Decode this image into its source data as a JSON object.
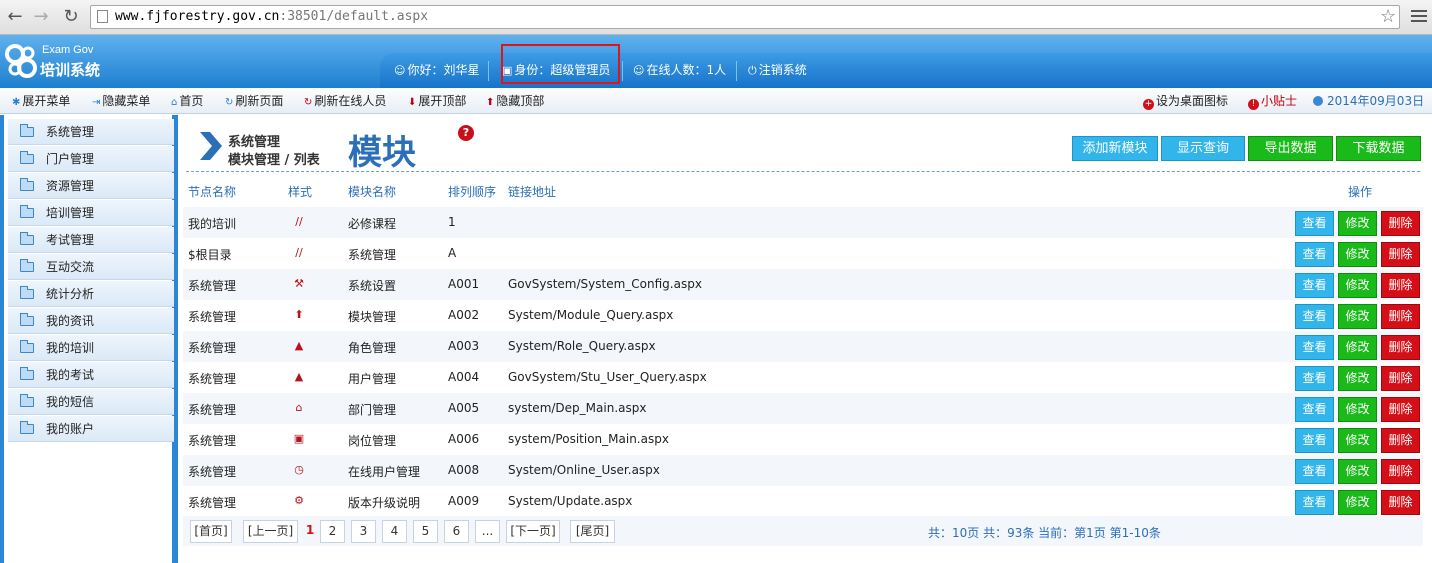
{
  "browser": {
    "url_host": "www.fjforestry.gov.cn",
    "url_rest": ":38501/default.aspx"
  },
  "app": {
    "logo_top": "Exam Gov",
    "logo_name": "培训系统"
  },
  "topnav": {
    "hello": "你好：刘华星",
    "identity": "身份：超级管理员",
    "online": "在线人数：1人",
    "logout": "注销系统"
  },
  "toolbar": {
    "expand_menu": "展开菜单",
    "hide_menu": "隐藏菜单",
    "home": "首页",
    "refresh_page": "刷新页面",
    "refresh_online": "刷新在线人员",
    "expand_top": "展开顶部",
    "hide_top": "隐藏顶部",
    "set_desktop_icon": "设为桌面图标",
    "tips": "小贴士",
    "date": "2014年09月03日"
  },
  "sidebar": {
    "items": [
      "系统管理",
      "门户管理",
      "资源管理",
      "培训管理",
      "考试管理",
      "互动交流",
      "统计分析",
      "我的资讯",
      "我的培训",
      "我的考试",
      "我的短信",
      "我的账户"
    ]
  },
  "main": {
    "breadcrumb_top": "系统管理",
    "breadcrumb_bottom": "模块管理 / 列表",
    "title": "模块",
    "help": "?",
    "buttons": {
      "add": "添加新模块",
      "show_query": "显示查询",
      "export": "导出数据",
      "download": "下载数据"
    },
    "columns": {
      "node": "节点名称",
      "style": "样式",
      "module": "模块名称",
      "order": "排列顺序",
      "link": "链接地址",
      "ops": "操作"
    },
    "rows": [
      {
        "node": "我的培训",
        "icon": "slash-icon",
        "module": "必修课程",
        "order": "1",
        "link": ""
      },
      {
        "node": "$根目录",
        "icon": "slash-icon",
        "module": "系统管理",
        "order": "A",
        "link": ""
      },
      {
        "node": "系统管理",
        "icon": "wrench-icon",
        "module": "系统设置",
        "order": "A001",
        "link": "GovSystem/System_Config.aspx"
      },
      {
        "node": "系统管理",
        "icon": "upload-circle-icon",
        "module": "模块管理",
        "order": "A002",
        "link": "System/Module_Query.aspx"
      },
      {
        "node": "系统管理",
        "icon": "user-icon",
        "module": "角色管理",
        "order": "A003",
        "link": "System/Role_Query.aspx"
      },
      {
        "node": "系统管理",
        "icon": "user-icon",
        "module": "用户管理",
        "order": "A004",
        "link": "GovSystem/Stu_User_Query.aspx"
      },
      {
        "node": "系统管理",
        "icon": "home-icon",
        "module": "部门管理",
        "order": "A005",
        "link": "system/Dep_Main.aspx"
      },
      {
        "node": "系统管理",
        "icon": "id-card-icon",
        "module": "岗位管理",
        "order": "A006",
        "link": "system/Position_Main.aspx"
      },
      {
        "node": "系统管理",
        "icon": "clock-icon",
        "module": "在线用户管理",
        "order": "A008",
        "link": "System/Online_User.aspx"
      },
      {
        "node": "系统管理",
        "icon": "gear-icon",
        "module": "版本升级说明",
        "order": "A009",
        "link": "System/Update.aspx"
      }
    ],
    "row_buttons": {
      "view": "查看",
      "edit": "修改",
      "delete": "删除"
    },
    "pager": {
      "first": "[首页]",
      "prev": "[上一页]",
      "pages": [
        "1",
        "2",
        "3",
        "4",
        "5",
        "6",
        "..."
      ],
      "next": "[下一页]",
      "last": "[尾页]",
      "info": "共：10页 共：93条 当前：第1页 第1-10条"
    }
  }
}
